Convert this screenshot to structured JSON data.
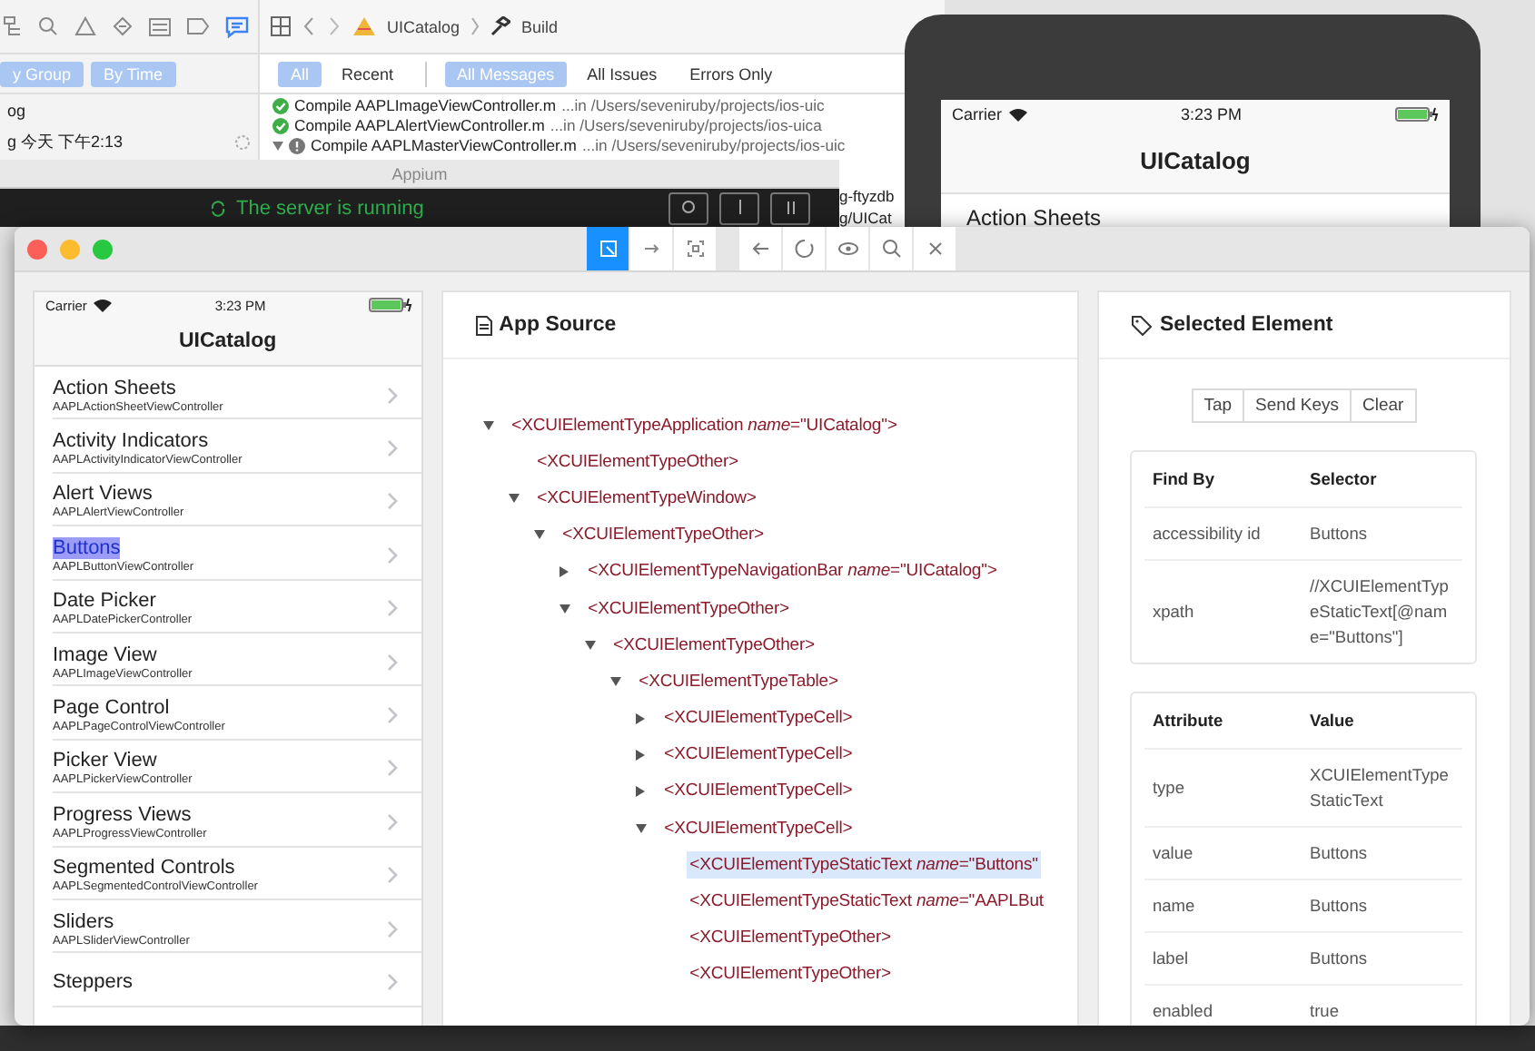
{
  "xcode": {
    "breadcrumb": [
      "UICatalog",
      "Build"
    ],
    "group_buttons": [
      {
        "label": "y Group",
        "selected": true
      },
      {
        "label": "By Time",
        "selected": true
      }
    ],
    "filters": [
      {
        "label": "All",
        "selected": true
      },
      {
        "label": "Recent",
        "selected": false
      }
    ],
    "scopes": [
      {
        "label": "All Messages",
        "selected": true
      },
      {
        "label": "All Issues",
        "selected": false
      },
      {
        "label": "Errors Only",
        "selected": false
      }
    ],
    "sessions": [
      "og",
      "g 今天 下午2:13"
    ],
    "log": [
      {
        "kind": "success",
        "text": "Compile AAPLImageViewController.m",
        "path": "...in /Users/seveniruby/projects/ios-uic"
      },
      {
        "kind": "success",
        "text": "Compile AAPLAlertViewController.m",
        "path": "...in /Users/seveniruby/projects/ios-uica"
      },
      {
        "kind": "group",
        "text": "Compile AAPLMasterViewController.m",
        "path": "...in /Users/seveniruby/projects/ios-uic"
      }
    ],
    "log_tail": [
      "g-ftyzdb",
      "g/UICat"
    ]
  },
  "appium_server": {
    "title": "Appium",
    "status": "The server is running"
  },
  "simulator": {
    "carrier": "Carrier",
    "time": "3:23 PM",
    "title": "UICatalog",
    "first_item": "Action Sheets"
  },
  "inspector": {
    "tools": [
      {
        "selected": true
      },
      {
        "selected": false
      },
      {
        "selected": false
      }
    ],
    "screenshot": {
      "carrier": "Carrier",
      "time": "3:23 PM",
      "title": "UICatalog",
      "items": [
        {
          "title": "Action Sheets",
          "subtitle": "AAPLActionSheetViewController",
          "selected": false
        },
        {
          "title": "Activity Indicators",
          "subtitle": "AAPLActivityIndicatorViewController",
          "selected": false
        },
        {
          "title": "Alert Views",
          "subtitle": "AAPLAlertViewController",
          "selected": false
        },
        {
          "title": "Buttons",
          "subtitle": "AAPLButtonViewController",
          "selected": true
        },
        {
          "title": "Date Picker",
          "subtitle": "AAPLDatePickerController",
          "selected": false
        },
        {
          "title": "Image View",
          "subtitle": "AAPLImageViewController",
          "selected": false
        },
        {
          "title": "Page Control",
          "subtitle": "AAPLPageControlViewController",
          "selected": false
        },
        {
          "title": "Picker View",
          "subtitle": "AAPLPickerViewController",
          "selected": false
        },
        {
          "title": "Progress Views",
          "subtitle": "AAPLProgressViewController",
          "selected": false
        },
        {
          "title": "Segmented Controls",
          "subtitle": "AAPLSegmentedControlViewController",
          "selected": false
        },
        {
          "title": "Sliders",
          "subtitle": "AAPLSliderViewController",
          "selected": false
        },
        {
          "title": "Steppers",
          "selected": false
        }
      ]
    },
    "source": {
      "title": "App Source",
      "tree": [
        {
          "label": "<XCUIElementTypeApplication *name*=\"UICatalog\">",
          "expanded": true,
          "selected": false,
          "children": [
            {
              "label": "<XCUIElementTypeOther>",
              "selected": false
            },
            {
              "label": "<XCUIElementTypeWindow>",
              "expanded": true,
              "selected": false,
              "children": [
                {
                  "label": "<XCUIElementTypeOther>",
                  "expanded": true,
                  "selected": false,
                  "children": [
                    {
                      "label": "<XCUIElementTypeNavigationBar *name*=\"UICatalog\">",
                      "expanded": false,
                      "selected": false
                    },
                    {
                      "label": "<XCUIElementTypeOther>",
                      "expanded": true,
                      "selected": false,
                      "children": [
                        {
                          "label": "<XCUIElementTypeOther>",
                          "expanded": true,
                          "selected": false,
                          "children": [
                            {
                              "label": "<XCUIElementTypeTable>",
                              "expanded": true,
                              "selected": false,
                              "children": [
                                {
                                  "label": "<XCUIElementTypeCell>",
                                  "expanded": false,
                                  "selected": false
                                },
                                {
                                  "label": "<XCUIElementTypeCell>",
                                  "expanded": false,
                                  "selected": false
                                },
                                {
                                  "label": "<XCUIElementTypeCell>",
                                  "expanded": false,
                                  "selected": false
                                },
                                {
                                  "label": "<XCUIElementTypeCell>",
                                  "expanded": true,
                                  "selected": false,
                                  "children": [
                                    {
                                      "label": "<XCUIElementTypeStaticText *name*=\"Buttons\"",
                                      "selected": true
                                    },
                                    {
                                      "label": "<XCUIElementTypeStaticText *name*=\"AAPLBut",
                                      "selected": false
                                    },
                                    {
                                      "label": "<XCUIElementTypeOther>",
                                      "selected": false
                                    },
                                    {
                                      "label": "<XCUIElementTypeOther>",
                                      "selected": false
                                    }
                                  ]
                                }
                              ]
                            }
                          ]
                        }
                      ]
                    }
                  ]
                }
              ]
            }
          ]
        }
      ]
    },
    "selected_element": {
      "title": "Selected Element",
      "actions": [
        "Tap",
        "Send Keys",
        "Clear"
      ],
      "selectors": {
        "columns": [
          "Find By",
          "Selector"
        ],
        "rows": [
          [
            "accessibility id",
            "Buttons"
          ],
          [
            "xpath",
            "//XCUIElementTypeStaticText[@name=\"Buttons\"]"
          ]
        ]
      },
      "attributes": {
        "columns": [
          "Attribute",
          "Value"
        ],
        "rows": [
          [
            "type",
            "XCUIElementTypeStaticText"
          ],
          [
            "value",
            "Buttons"
          ],
          [
            "name",
            "Buttons"
          ],
          [
            "label",
            "Buttons"
          ],
          [
            "enabled",
            "true"
          ]
        ]
      }
    }
  }
}
